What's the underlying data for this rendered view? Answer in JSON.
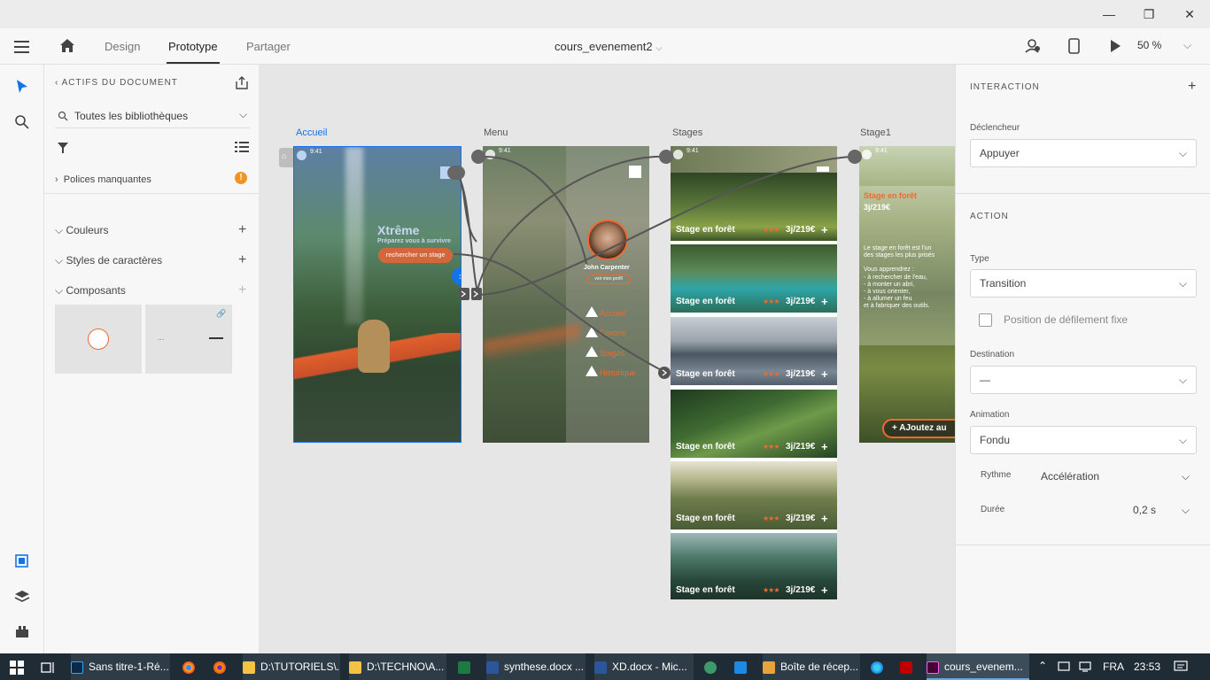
{
  "window": {
    "minimize": "—",
    "maximize": "❐",
    "close": "✕"
  },
  "appbar": {
    "tabs": [
      "Design",
      "Prototype",
      "Partager"
    ],
    "document": "cours_evenement2",
    "zoom": "50 %"
  },
  "assets": {
    "title": "ACTIFS DU DOCUMENT",
    "library": "Toutes les bibliothèques",
    "missing_fonts": "Polices manquantes",
    "colors": "Couleurs",
    "char_styles": "Styles de caractères",
    "components": "Composants",
    "component_ellipsis": "..."
  },
  "artboards": {
    "accueil": {
      "label": "Accueil",
      "time": "9:41",
      "headline": "Xtrême",
      "subline": "Préparez vous à survivre",
      "button": "rechercher un stage"
    },
    "menu": {
      "label": "Menu",
      "time": "9:41",
      "name": "John Carpenter",
      "profile": "voir mon profil",
      "items": [
        "Accueil",
        "Favoris",
        "Stages",
        "Historique"
      ]
    },
    "stages": {
      "label": "Stages",
      "time": "9:41",
      "cards": [
        {
          "title": "Stage en forêt",
          "stars": "★★★",
          "price": "3j/219€",
          "plus": "+"
        },
        {
          "title": "Stage en forêt",
          "stars": "★★★",
          "price": "3j/219€",
          "plus": "+"
        },
        {
          "title": "Stage en forêt",
          "stars": "★★★",
          "price": "3j/219€",
          "plus": "+"
        },
        {
          "title": "Stage en forêt",
          "stars": "★★★",
          "price": "3j/219€",
          "plus": "+"
        },
        {
          "title": "Stage en forêt",
          "stars": "★★★",
          "price": "3j/219€",
          "plus": "+"
        },
        {
          "title": "Stage en forêt",
          "stars": "★★★",
          "price": "3j/219€",
          "plus": "+"
        }
      ]
    },
    "stage1": {
      "label": "Stage1",
      "time": "9:41",
      "title": "Stage en forêt",
      "duration": "3j/219€",
      "intro1": "Le stage en forêt est l'un",
      "intro2": "des stages les plus prisés",
      "learn": "Vous apprendrez :",
      "bullets": [
        "- à rechercher de l'eau,",
        "- à monter un abri,",
        "- à vous orienter,",
        "- à allumer un feu",
        "et à fabriquer des outils."
      ],
      "cta": "+ AJoutez au"
    }
  },
  "interaction": {
    "section": "INTERACTION",
    "trigger_label": "Déclencheur",
    "trigger": "Appuyer",
    "action_section": "ACTION",
    "type_label": "Type",
    "type": "Transition",
    "scroll_label": "Position de défilement fixe",
    "dest_label": "Destination",
    "dest": "—",
    "anim_label": "Animation",
    "anim": "Fondu",
    "rhythm_label": "Rythme",
    "rhythm": "Accélération",
    "duration_label": "Durée",
    "duration": "0,2 s"
  },
  "taskbar": {
    "items": [
      "Sans titre-1-Ré...",
      "D:\\TUTORIELS\\...",
      "D:\\TECHNO\\A...",
      "synthese.docx ...",
      "XD.docx - Mic...",
      "Boîte de récep...",
      "cours_evenem..."
    ],
    "lang": "FRA",
    "time": "23:53"
  },
  "colors": {
    "accent": "#f06a2e",
    "blue": "#1473e6",
    "taskbar": "#1f2b35"
  }
}
